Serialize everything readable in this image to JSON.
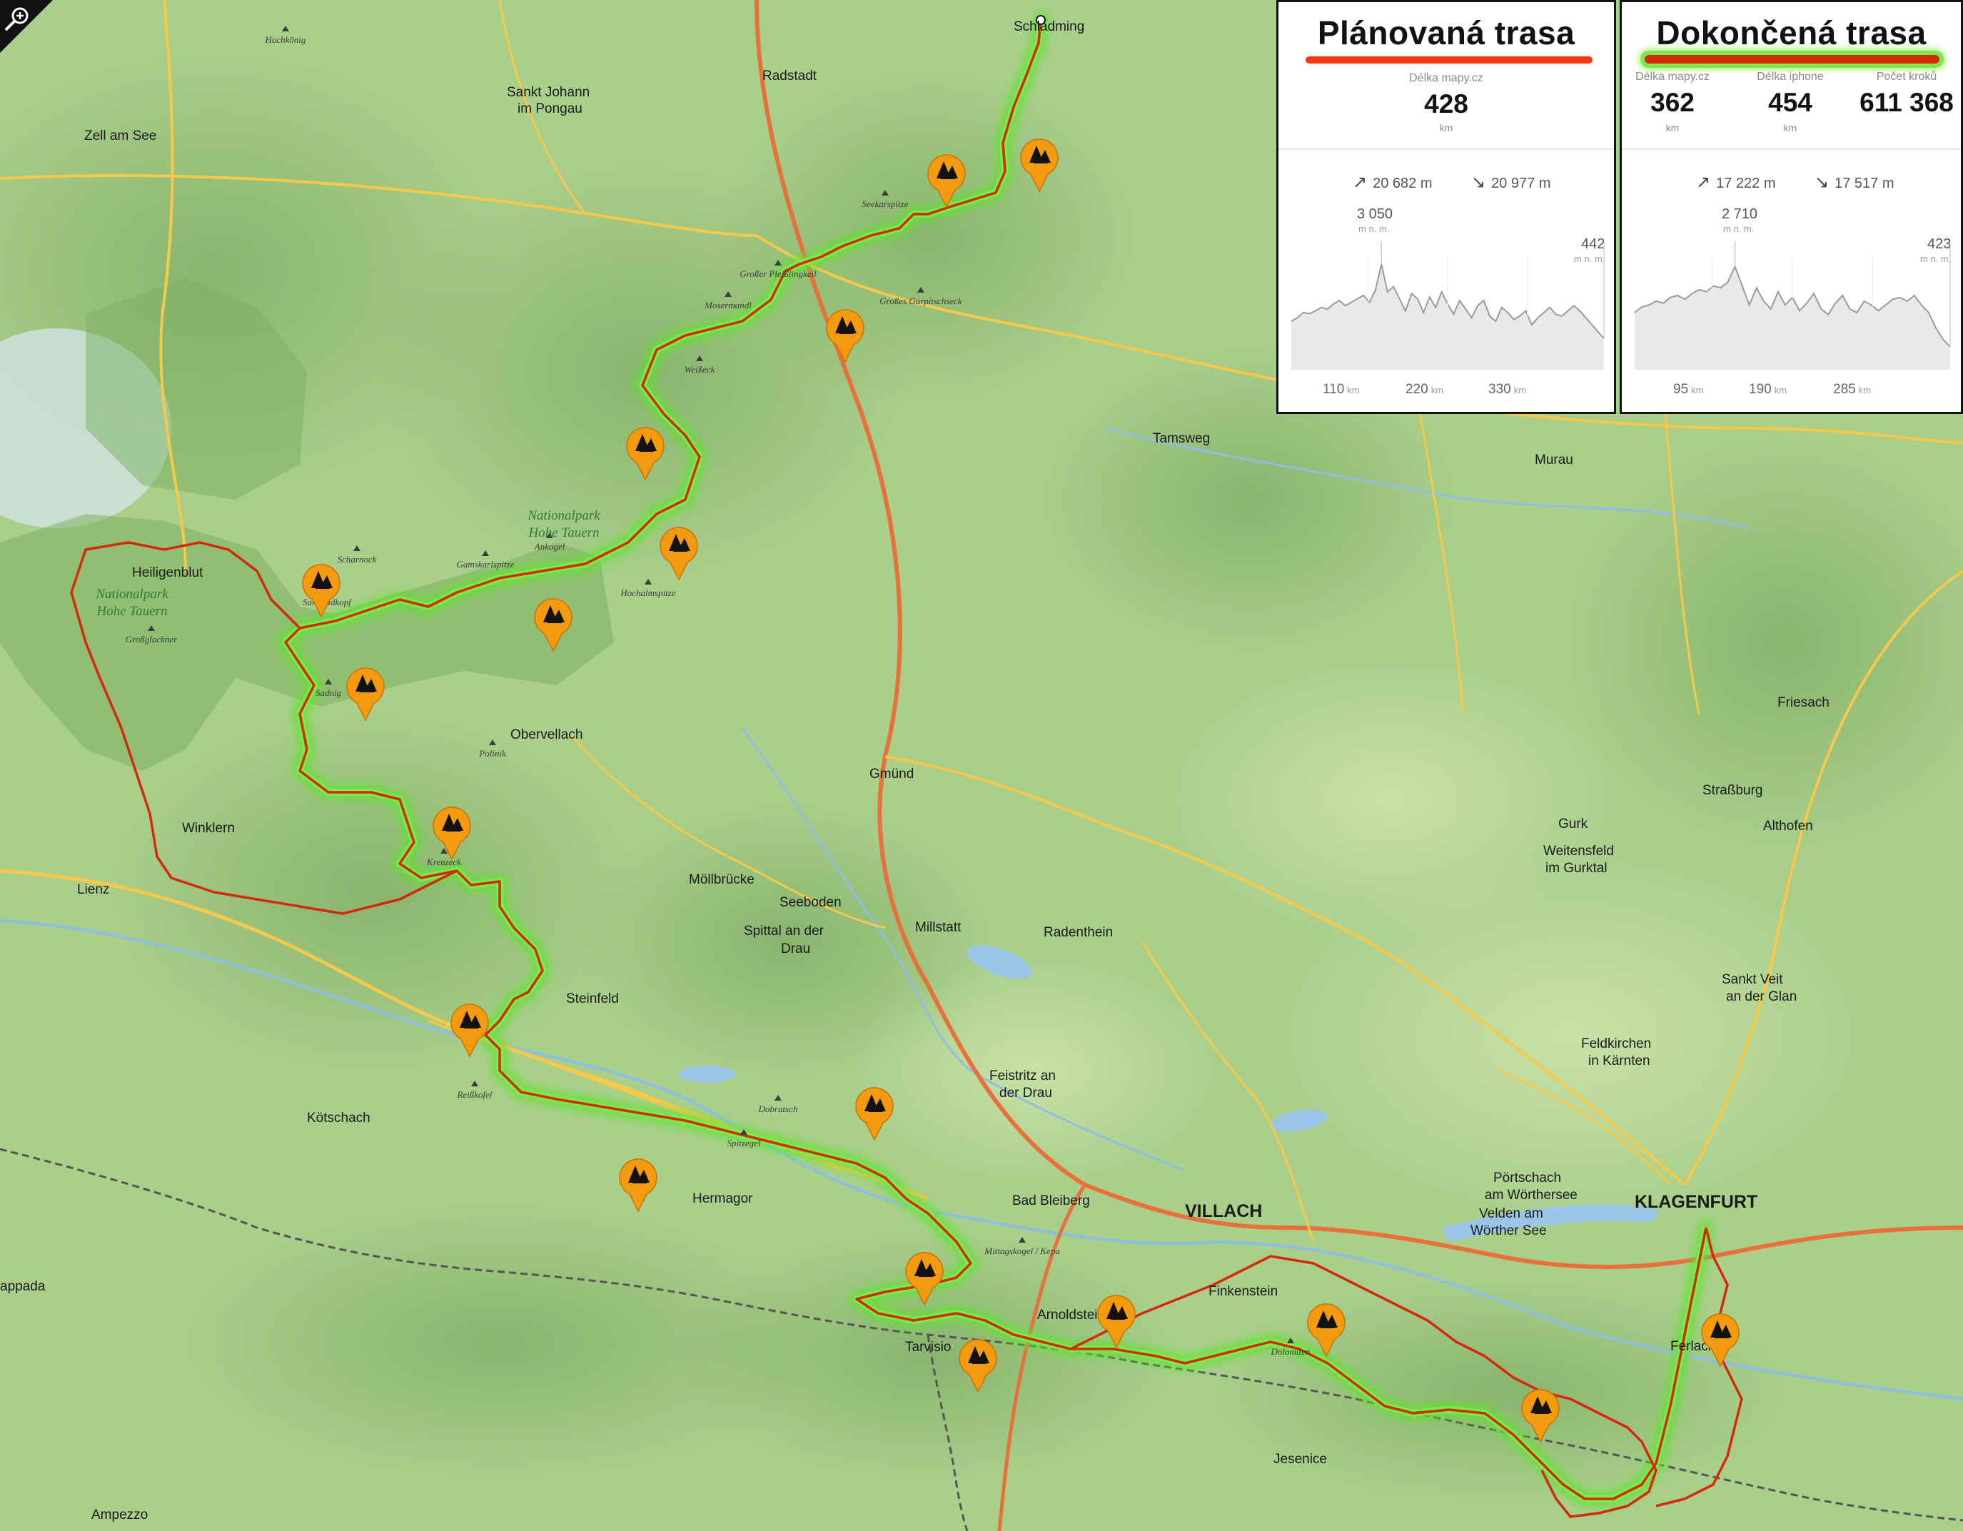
{
  "colors": {
    "terrain": "#a8cf8a",
    "planned_route": "#d42a0c",
    "completed_glow": "#5fe32d",
    "camp_marker": "#f39a0e",
    "road": "#f7c94a",
    "motorway": "#e8703a"
  },
  "toolbar": {
    "zoom_icon": "magnifier-plus-icon"
  },
  "map": {
    "places": [
      {
        "name": "Schladming",
        "cls": "town",
        "anchor": "start"
      },
      {
        "name": "Radstadt",
        "cls": "town",
        "anchor": "start"
      },
      {
        "name": "Sankt Johann",
        "cls": "town",
        "anchor": "start"
      },
      {
        "name": "im Pongau",
        "cls": "town",
        "anchor": "start"
      },
      {
        "name": "Zell am See",
        "cls": "town",
        "anchor": "start"
      },
      {
        "name": "Heiligenblut",
        "cls": "town",
        "anchor": "start"
      },
      {
        "name": "Winklern",
        "cls": "town",
        "anchor": "start"
      },
      {
        "name": "Lienz",
        "cls": "town",
        "anchor": "start"
      },
      {
        "name": "Obervellach",
        "cls": "town",
        "anchor": "start"
      },
      {
        "name": "Gmünd",
        "cls": "town",
        "anchor": "start"
      },
      {
        "name": "Möllbrücke",
        "cls": "town",
        "anchor": "start"
      },
      {
        "name": "Seeboden",
        "cls": "town",
        "anchor": "start"
      },
      {
        "name": "Spittal an der",
        "cls": "town",
        "anchor": "start"
      },
      {
        "name": "Drau",
        "cls": "town",
        "anchor": "start"
      },
      {
        "name": "Millstatt",
        "cls": "town",
        "anchor": "start"
      },
      {
        "name": "Radenthein",
        "cls": "town",
        "anchor": "start"
      },
      {
        "name": "Tamsweg",
        "cls": "town",
        "anchor": "start"
      },
      {
        "name": "Murau",
        "cls": "town",
        "anchor": "start"
      },
      {
        "name": "Friesach",
        "cls": "town",
        "anchor": "start"
      },
      {
        "name": "Straßburg",
        "cls": "town",
        "anchor": "start"
      },
      {
        "name": "Gurk",
        "cls": "town",
        "anchor": "start"
      },
      {
        "name": "Althofen",
        "cls": "town",
        "anchor": "start"
      },
      {
        "name": "Weitensfeld",
        "cls": "town",
        "anchor": "start"
      },
      {
        "name": "im Gurktal",
        "cls": "town",
        "anchor": "start"
      },
      {
        "name": "Sankt Veit",
        "cls": "town",
        "anchor": "start"
      },
      {
        "name": "an der Glan",
        "cls": "town",
        "anchor": "start"
      },
      {
        "name": "Feldkirchen",
        "cls": "town",
        "anchor": "start"
      },
      {
        "name": "in Kärnten",
        "cls": "town",
        "anchor": "start"
      },
      {
        "name": "Steinfeld",
        "cls": "town",
        "anchor": "start"
      },
      {
        "name": "Kötschach",
        "cls": "town",
        "anchor": "start"
      },
      {
        "name": "Hermagor",
        "cls": "town",
        "anchor": "start"
      },
      {
        "name": "Feistritz an",
        "cls": "town",
        "anchor": "start"
      },
      {
        "name": "der Drau",
        "cls": "town",
        "anchor": "start"
      },
      {
        "name": "Bad Bleiberg",
        "cls": "town",
        "anchor": "start"
      },
      {
        "name": "VILLACH",
        "cls": "big",
        "anchor": "start"
      },
      {
        "name": "Velden am",
        "cls": "town",
        "anchor": "start"
      },
      {
        "name": "Wörther See",
        "cls": "town",
        "anchor": "start"
      },
      {
        "name": "Pörtschach",
        "cls": "town",
        "anchor": "start"
      },
      {
        "name": "am Wörthersee",
        "cls": "town",
        "anchor": "start"
      },
      {
        "name": "KLAGENFURT",
        "cls": "big",
        "anchor": "start"
      },
      {
        "name": "Finkenstein",
        "cls": "town",
        "anchor": "start"
      },
      {
        "name": "Arnoldstein",
        "cls": "town",
        "anchor": "start"
      },
      {
        "name": "Tarvisio",
        "cls": "town",
        "anchor": "start"
      },
      {
        "name": "Ferlach",
        "cls": "town",
        "anchor": "start"
      },
      {
        "name": "Jesenice",
        "cls": "town",
        "anchor": "start"
      },
      {
        "name": "Ampezzo",
        "cls": "town",
        "anchor": "start"
      },
      {
        "name": "appada",
        "cls": "town",
        "anchor": "start"
      }
    ],
    "peaks": [
      "Hochkönig",
      "Großer Pleißlingkeil",
      "Seekarspitze",
      "Mosermandl",
      "Weißeck",
      "Großes Gurpitschseck",
      "Scharnock",
      "Hochalmspitze",
      "Ankogel",
      "Gamskarlspitze",
      "Sandfeldkopf",
      "Sadnig",
      "Großglockner",
      "Polinik",
      "Kreuzeck",
      "Reißkofel",
      "Spitzegel",
      "Dobratsch",
      "Mittagskogel / Kepa",
      "Dolomiten"
    ],
    "park_labels": [
      "Nationalpark",
      "Hohe Tauern",
      "Nationalpark",
      "Hohe Tauern"
    ]
  },
  "panels": {
    "planned": {
      "title": "Plánovaná trasa",
      "stat_label": "Délka mapy.cz",
      "stat_value": "428",
      "stat_unit": "km",
      "ascent": "20 682 m",
      "descent": "20 977 m",
      "max_elev": "3 050",
      "max_unit": "m n. m.",
      "end_elev": "442",
      "end_unit": "m n. m.",
      "km_ticks": [
        {
          "v": "110",
          "u": "km"
        },
        {
          "v": "220",
          "u": "km"
        },
        {
          "v": "330",
          "u": "km"
        }
      ],
      "profile": [
        1400,
        1500,
        1650,
        1620,
        1700,
        1800,
        1750,
        1900,
        2000,
        1850,
        1950,
        2050,
        2150,
        1950,
        2300,
        3050,
        2250,
        2400,
        2050,
        1700,
        2200,
        2050,
        1650,
        2100,
        1800,
        2250,
        1900,
        1600,
        2000,
        1750,
        1500,
        1850,
        2000,
        1550,
        1400,
        1800,
        1650,
        1450,
        1550,
        1700,
        1300,
        1500,
        1650,
        1800,
        1600,
        1550,
        1700,
        1850,
        1700,
        1500,
        1300,
        1100,
        900
      ]
    },
    "completed": {
      "title": "Dokončená trasa",
      "stat1_label": "Délka mapy.cz",
      "stat1_value": "362",
      "stat1_unit": "km",
      "stat2_label": "Délka iphone",
      "stat2_value": "454",
      "stat2_unit": "km",
      "stat3_label": "Počet kroků",
      "stat3_value": "611 368",
      "ascent": "17 222 m",
      "descent": "17 517 m",
      "max_elev": "2 710",
      "max_unit": "m n. m.",
      "end_elev": "423",
      "end_unit": "m n. m.",
      "km_ticks": [
        {
          "v": "95",
          "u": "km"
        },
        {
          "v": "190",
          "u": "km"
        },
        {
          "v": "285",
          "u": "km"
        }
      ],
      "profile": [
        1500,
        1650,
        1700,
        1800,
        1750,
        1900,
        1950,
        1850,
        2000,
        2100,
        2050,
        2200,
        2150,
        2300,
        2710,
        2200,
        1700,
        2150,
        1800,
        1600,
        2050,
        1700,
        1900,
        1550,
        1750,
        2000,
        1600,
        1450,
        1750,
        1950,
        1600,
        1500,
        1800,
        1700,
        1550,
        1700,
        1850,
        1900,
        1800,
        1950,
        1700,
        1500,
        1100,
        800,
        600
      ]
    }
  }
}
